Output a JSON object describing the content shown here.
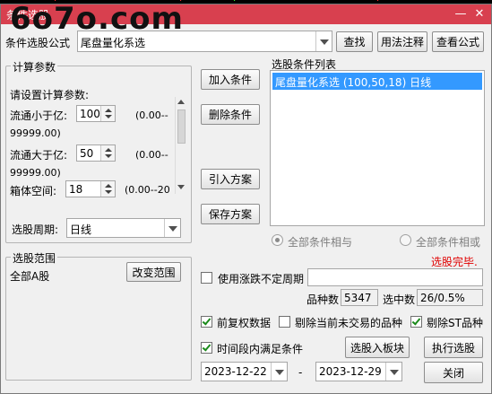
{
  "window": {
    "title": "条件选股",
    "watermark": "6o7o.com",
    "minimize_glyph": "—",
    "close_glyph": "✕"
  },
  "formula": {
    "label": "条件选股公式",
    "value": "尾盘量化系选",
    "find_button": "查找",
    "usage_button": "用法注释",
    "view_button": "查看公式"
  },
  "params": {
    "group_title": "计算参数",
    "prompt": "请设置计算参数:",
    "items": [
      {
        "label": "流通小于亿:",
        "value": "100",
        "range_a": "(0.00--",
        "range_b": "99999.00)"
      },
      {
        "label": "流通大于亿:",
        "value": "50",
        "range_a": "(0.00--",
        "range_b": "99999.00)"
      },
      {
        "label": "箱体空间:",
        "value": "18",
        "range_a": "(0.00--20"
      }
    ],
    "period_label": "选股周期:",
    "period_value": "日线"
  },
  "actions": {
    "add": "加入条件",
    "delete": "删除条件",
    "import": "引入方案",
    "save": "保存方案"
  },
  "conditions": {
    "title": "选股条件列表",
    "items": [
      "尾盘量化系选 (100,50,18) 日线"
    ],
    "radio_and": "全部条件相与",
    "radio_or": "全部条件相或",
    "status": "选股完毕."
  },
  "range": {
    "group_title": "选股范围",
    "value": "全部A股",
    "change_button": "改变范围"
  },
  "options": {
    "use_undetermined_period": "使用涨跌不定周期",
    "count_label": "品种数",
    "count_value": "5347",
    "selected_label": "选中数",
    "selected_value": "26/0.5%",
    "pre_adjust": "前复权数据",
    "exclude_untraded": "剔除当前未交易的品种",
    "exclude_st": "剔除ST品种",
    "time_range": "时间段内满足条件",
    "to_block_button": "选股入板块",
    "execute_button": "执行选股",
    "start_date": "2023-12-22",
    "dash": "-",
    "end_date": "2023-12-29",
    "close_button": "关闭"
  },
  "colors": {
    "title_bar": "#d8404f",
    "selection": "#3399ff",
    "status_red": "#e00000",
    "check_green": "#1b8a1b"
  }
}
